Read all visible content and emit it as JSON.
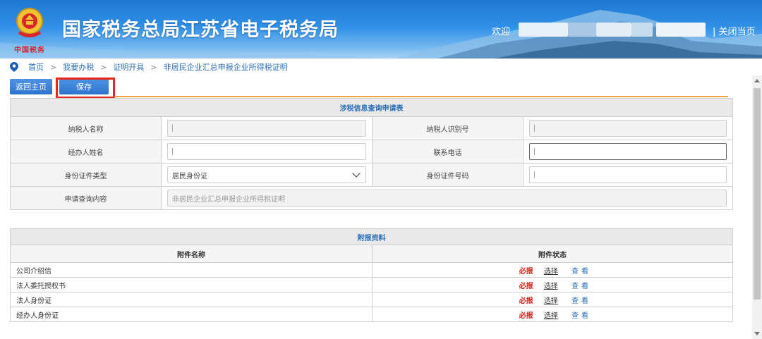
{
  "header": {
    "emblem_text": "中国税务",
    "site_title": "国家税务总局江苏省电子税务局",
    "welcome": "欢迎",
    "close_link": "| 关闭当页",
    "colors": {
      "banner_top": "#1f78d1",
      "banner_bottom": "#a9d3f3",
      "title": "#ffffff"
    }
  },
  "breadcrumb": {
    "items": [
      "首页",
      "我要办税",
      "证明开具",
      "非居民企业汇总申报企业所得税证明"
    ],
    "separator": ">"
  },
  "toolbar": {
    "home_label": "返回主页",
    "save_label": "保存"
  },
  "form": {
    "title": "涉税信息查询申请表",
    "taxpayer_name_label": "纳税人名称",
    "taxpayer_id_label": "纳税人识别号",
    "agent_name_label": "经办人姓名",
    "phone_label": "联系电话",
    "id_type_label": "身份证件类型",
    "id_type_value": "居民身份证",
    "id_number_label": "身份证件号码",
    "query_content_label": "申请查询内容",
    "query_content_value": "非居民企业汇总申报企业所得税证明"
  },
  "attachments": {
    "title": "附报资料",
    "col_name": "附件名称",
    "col_status": "附件状态",
    "rows": [
      {
        "name": "公司介绍信",
        "required": "必报",
        "select": "选择",
        "view": "查看"
      },
      {
        "name": "法人委托授权书",
        "required": "必报",
        "select": "选择",
        "view": "查看"
      },
      {
        "name": "法人身份证",
        "required": "必报",
        "select": "选择",
        "view": "查看"
      },
      {
        "name": "经办人身份证",
        "required": "必报",
        "select": "选择",
        "view": "查看"
      }
    ]
  },
  "colors": {
    "accent_blue": "#2a6db5",
    "required_red": "#e0201b",
    "highlight_red": "#e8241b",
    "divider_orange": "#f1a33b"
  },
  "icons": {
    "location": "map-pin-icon",
    "emblem": "tax-emblem-icon",
    "dropdown": "chevron-down-icon"
  }
}
